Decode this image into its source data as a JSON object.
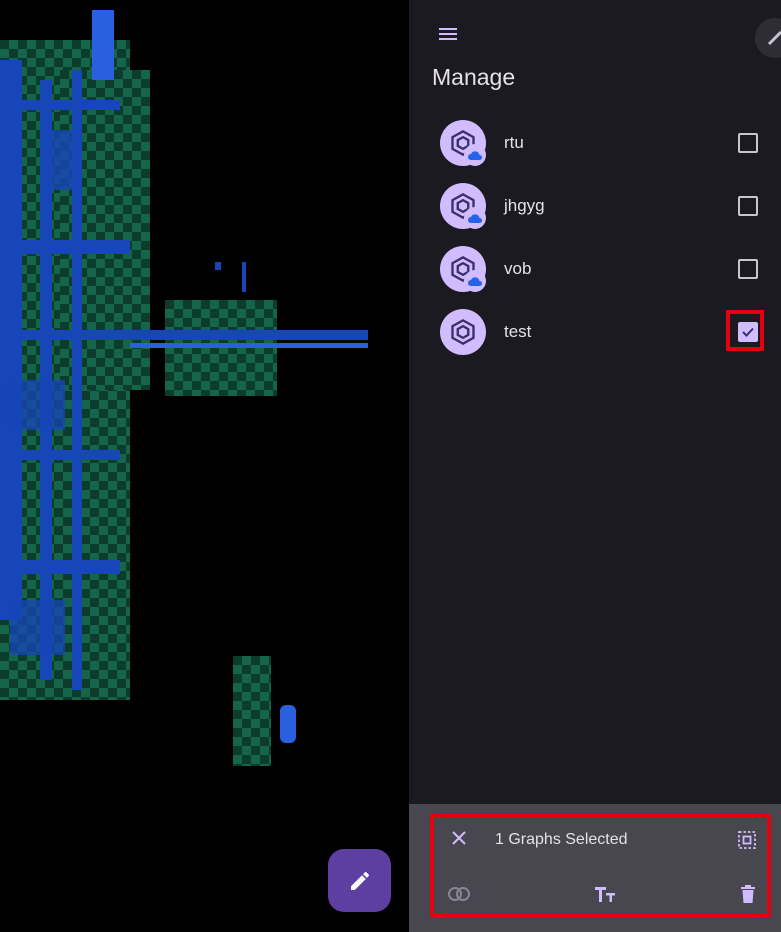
{
  "panel": {
    "title": "Manage",
    "graphs": [
      {
        "name": "rtu",
        "cloud": true,
        "checked": false
      },
      {
        "name": "jhgyg",
        "cloud": true,
        "checked": false
      },
      {
        "name": "vob",
        "cloud": true,
        "checked": false
      },
      {
        "name": "test",
        "cloud": false,
        "checked": true
      }
    ]
  },
  "selection_bar": {
    "text": "1 Graphs Selected"
  },
  "icons": {
    "menu": "menu-icon",
    "close": "close-icon",
    "select_all": "select-all-icon",
    "merge": "merge-icon",
    "text_size": "text-size-icon",
    "delete": "delete-icon",
    "graph": "cube-icon",
    "cloud": "cloud-icon",
    "edit": "pencil-icon"
  },
  "colors": {
    "accent": "#d0bcff",
    "fab": "#5c3fa0",
    "highlight": "#e3000f",
    "panel_bg": "#1b1a20",
    "bar_bg": "#48464f"
  }
}
